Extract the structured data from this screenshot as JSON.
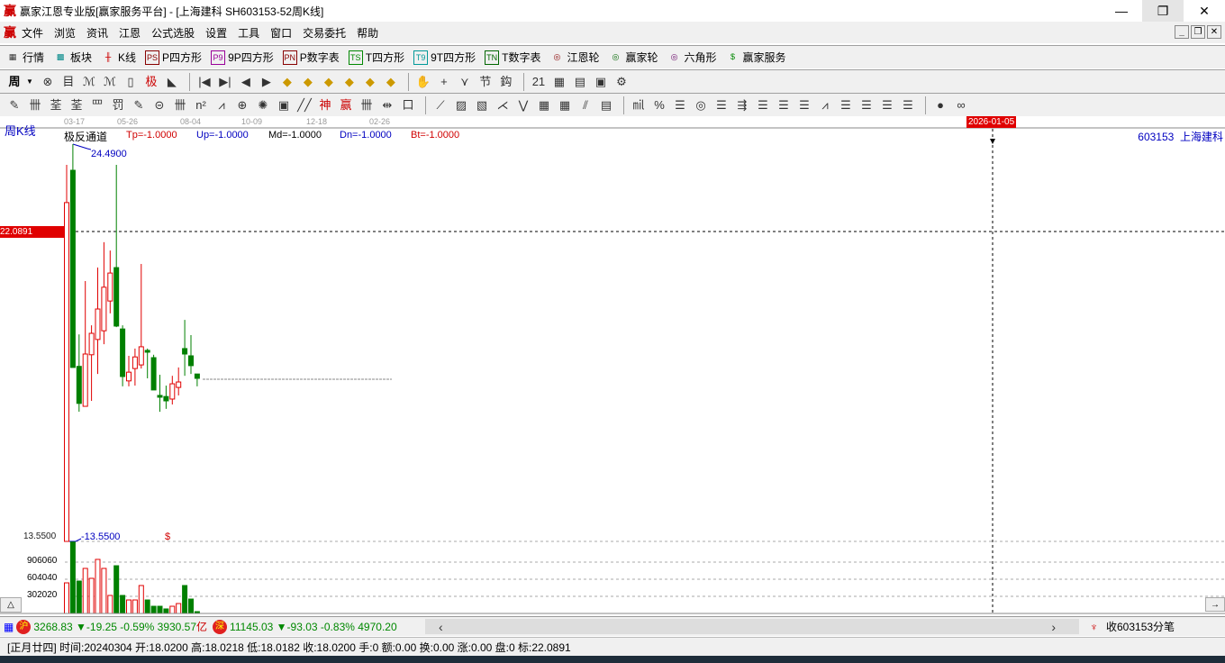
{
  "window": {
    "title": "赢家江恩专业版[赢家服务平台] - [上海建科  SH603153-52周K线]",
    "logo": "赢",
    "minimize": "—",
    "restore": "❐",
    "close": "✕"
  },
  "menu": [
    "文件",
    "浏览",
    "资讯",
    "江恩",
    "公式选股",
    "设置",
    "工具",
    "窗口",
    "交易委托",
    "帮助"
  ],
  "toolbar1": [
    {
      "icon": "grid-icon",
      "glyph": "▦",
      "label": "行情"
    },
    {
      "icon": "blocks-icon",
      "glyph": "▩",
      "label": "板块"
    },
    {
      "icon": "kline-icon",
      "glyph": "╫",
      "label": "K线"
    },
    {
      "icon": "ps-icon",
      "glyph": "PS",
      "label": "P四方形"
    },
    {
      "icon": "p9-icon",
      "glyph": "P9",
      "label": "9P四方形"
    },
    {
      "icon": "pn-icon",
      "glyph": "PN",
      "label": "P数字表"
    },
    {
      "icon": "ts-icon",
      "glyph": "TS",
      "label": "T四方形"
    },
    {
      "icon": "t9-icon",
      "glyph": "T9",
      "label": "9T四方形"
    },
    {
      "icon": "tn-icon",
      "glyph": "TN",
      "label": "T数字表"
    },
    {
      "icon": "target-icon",
      "glyph": "◎",
      "label": "江恩轮"
    },
    {
      "icon": "wheel-icon",
      "glyph": "◎",
      "label": "赢家轮"
    },
    {
      "icon": "hexagon-icon",
      "glyph": "◎",
      "label": "六角形"
    },
    {
      "icon": "dollar-icon",
      "glyph": "$",
      "label": "赢家服务"
    }
  ],
  "toolbar2": {
    "period": "周",
    "icons": [
      "⊗",
      "目",
      "ℳ",
      "ℳ",
      "▯",
      "极",
      "◣",
      "|◀",
      "▶|",
      "◀",
      "▶",
      "◆",
      "◆",
      "◆",
      "◆",
      "◆",
      "◆",
      "✋",
      "+",
      "⋎",
      "节",
      "鈎",
      "21",
      "▦",
      "▤",
      "▣",
      "⚙"
    ]
  },
  "toolbar3": {
    "icons": [
      "✎",
      "卌",
      "荃",
      "荃",
      "罒",
      "罚",
      "✎",
      "⊝",
      "卌",
      "n²",
      "⩘",
      "⊕",
      "✺",
      "▣",
      "╱╱",
      "神",
      "赢",
      "卌",
      "⇹",
      "口",
      "⟋",
      "▨",
      "▧",
      "⋌",
      "⋁",
      "▦",
      "▦",
      "⫽",
      "▤",
      "㏕",
      "%",
      "☰",
      "◎",
      "☰",
      "⇶",
      "☰",
      "☰",
      "☰",
      "⩘",
      "☰",
      "☰",
      "☰",
      "☰",
      "●",
      "∞"
    ]
  },
  "chart": {
    "period_label": "周K线",
    "date_ticks": [
      "03-17",
      "05-26",
      "08-04",
      "10-09",
      "12-18",
      "02-26"
    ],
    "indicator_name": "极反通道",
    "params": [
      {
        "text": "Tp=-1.0000",
        "color": "#d00000"
      },
      {
        "text": "Up=-1.0000",
        "color": "#0000c0"
      },
      {
        "text": "Md=-1.0000",
        "color": "#000000"
      },
      {
        "text": "Dn=-1.0000",
        "color": "#0000c0"
      },
      {
        "text": "Bt=-1.0000",
        "color": "#d00000"
      }
    ],
    "cursor_date": "2026-01-05",
    "stock": "603153  上海建科",
    "high_label": "24.4900",
    "low_label": "-13.5500",
    "low_axis": "13.5500",
    "cursor_price": "22.0891",
    "dollar_mark": "$",
    "vol_ticks": [
      "906060",
      "604040",
      "302020"
    ],
    "collapse_btn": "△",
    "scroll_btn": "→"
  },
  "chart_data": {
    "type": "candlestick",
    "ylim": [
      13.55,
      24.49
    ],
    "up_color": "#e00000",
    "down_color": "#008000",
    "candles": [
      [
        13.55,
        22.88,
        23.92,
        13.55
      ],
      [
        23.77,
        18.34,
        24.49,
        18.34
      ],
      [
        18.37,
        17.35,
        19.25,
        17.12
      ],
      [
        17.27,
        18.71,
        20.72,
        17.27
      ],
      [
        18.69,
        19.28,
        19.5,
        17.42
      ],
      [
        19.11,
        19.95,
        21.09,
        18.16
      ],
      [
        19.35,
        20.55,
        21.79,
        18.98
      ],
      [
        20.17,
        20.94,
        21.56,
        19.83
      ],
      [
        21.09,
        19.48,
        23.92,
        19.45
      ],
      [
        19.4,
        18.09,
        19.5,
        17.82
      ],
      [
        17.97,
        18.21,
        18.66,
        17.82
      ],
      [
        18.31,
        18.63,
        18.86,
        17.84
      ],
      [
        18.41,
        18.91,
        21.19,
        18.31
      ],
      [
        18.81,
        18.76,
        18.86,
        18.04
      ],
      [
        18.61,
        17.72,
        18.69,
        17.72
      ],
      [
        17.57,
        17.52,
        18.14,
        17.12
      ],
      [
        17.54,
        17.42,
        17.84,
        17.2
      ],
      [
        17.47,
        17.89,
        18.11,
        17.32
      ],
      [
        17.79,
        17.94,
        18.34,
        17.57
      ],
      [
        18.86,
        18.71,
        19.65,
        18.11
      ],
      [
        18.66,
        18.39,
        19.23,
        18.16
      ],
      [
        18.16,
        18.04,
        18.16,
        17.82
      ]
    ],
    "volumes": [
      540000,
      1260000,
      572000,
      795000,
      620000,
      954000,
      795000,
      318000,
      842000,
      318000,
      238000,
      238000,
      493000,
      238000,
      127000,
      127000,
      80000,
      127000,
      175000,
      493000,
      254000,
      32000
    ],
    "vol_max": 1208080
  },
  "ticker": {
    "sh_badge": "沪",
    "sh": "3268.83 ▼-19.25 -0.59% 3930.57",
    "sh_unit": "亿",
    "sz_badge": "深",
    "sz": "11145.03 ▼-93.03 -0.83% 4970.20",
    "left": "‹",
    "right": "›",
    "receive": "收603153分笔"
  },
  "status": "[正月廿四] 时间:20240304 开:18.0200 高:18.0218 低:18.0182 收:18.0200 手:0 额:0.00 换:0.00 涨:0.00 盘:0 标:22.0891"
}
